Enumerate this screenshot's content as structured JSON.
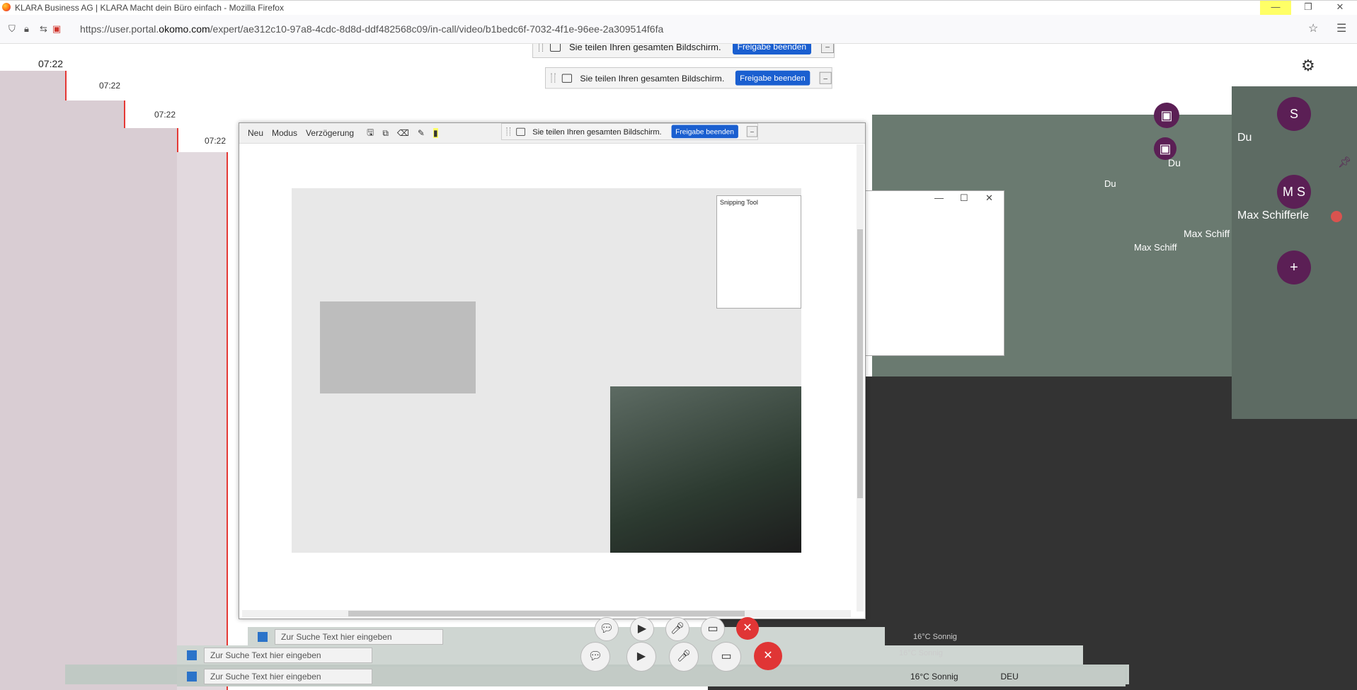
{
  "window": {
    "title": "KLARA Business AG | KLARA Macht dein Büro einfach - Mozilla Firefox",
    "minimize_glyph": "—",
    "maximize_glyph": "❐",
    "close_glyph": "✕"
  },
  "browser": {
    "url_prefix": "https://user.portal.",
    "url_domain": "okomo.com",
    "url_suffix": "/expert/ae312c10-97a8-4cdc-8d8d-ddf482568c09/in-call/video/b1bedc6f-7032-4f1e-96ee-2a309514f6fa"
  },
  "share_bar": {
    "message": "Sie teilen Ihren gesamten Bildschirm.",
    "stop_label": "Freigabe beenden",
    "hide_label": "_"
  },
  "call": {
    "time": "07:22",
    "echo_times": [
      "07:22",
      "07:22",
      "07:22"
    ]
  },
  "participants": [
    {
      "initials": "S",
      "name": "Du"
    },
    {
      "initials": "M S",
      "name": "Max Schifferle"
    }
  ],
  "echo_names": [
    "Du",
    "Max Schiff"
  ],
  "snipping_tool": {
    "new_label": "Neu",
    "mode_label": "Modus",
    "delay_label": "Verzögerung",
    "inner_title": "Snipping Tool"
  },
  "taskbar": {
    "search_placeholder": "Zur Suche Text hier eingeben",
    "weather": "16°C Sonnig",
    "lang": "DEU"
  },
  "colors": {
    "accent": "#1a5fd0",
    "avatar": "#5b1f55",
    "red_line": "#e53935",
    "panel_green": "#5d6b63"
  }
}
